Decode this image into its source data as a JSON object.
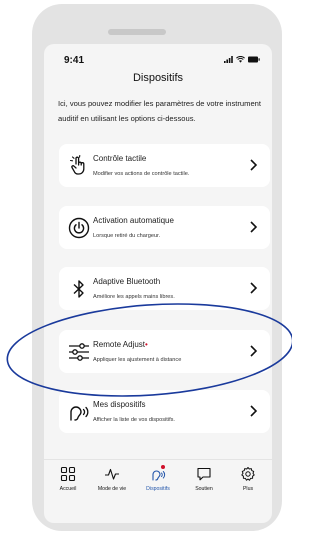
{
  "status_bar": {
    "time": "9:41"
  },
  "header": {
    "title": "Dispositifs"
  },
  "intro_text": "Ici, vous pouvez modifier les paramètres de votre instrument auditif en utilisant les options ci-dessous.",
  "cards": [
    {
      "title": "Contrôle tactile",
      "desc": "Modifier vos actions de contrôle tactile.",
      "icon": "touch-icon"
    },
    {
      "title": "Activation automatique",
      "desc": "Lorsque retiré du chargeur.",
      "icon": "power-icon"
    },
    {
      "title": "Adaptive Bluetooth",
      "desc": "Améliore les appels mains libres.",
      "icon": "bluetooth-icon"
    },
    {
      "title": "Remote Adjust",
      "desc": "Appliquer les ajustement à distance",
      "icon": "sliders-icon",
      "badge": "•"
    },
    {
      "title": "Mes dispositifs",
      "desc": "Afficher la liste de vos dispositifs.",
      "icon": "hearing-device-icon"
    }
  ],
  "tabs": [
    {
      "label": "Accueil",
      "icon": "grid-icon"
    },
    {
      "label": "Mode de vie",
      "icon": "pulse-icon"
    },
    {
      "label": "Dispositifs",
      "icon": "devices-icon",
      "active": true
    },
    {
      "label": "Soutien",
      "icon": "chat-icon"
    },
    {
      "label": "Plus",
      "icon": "gear-icon"
    }
  ],
  "colors": {
    "accent": "#2255aa",
    "alert": "#d0112b",
    "annotation": "#1a3a9c"
  }
}
